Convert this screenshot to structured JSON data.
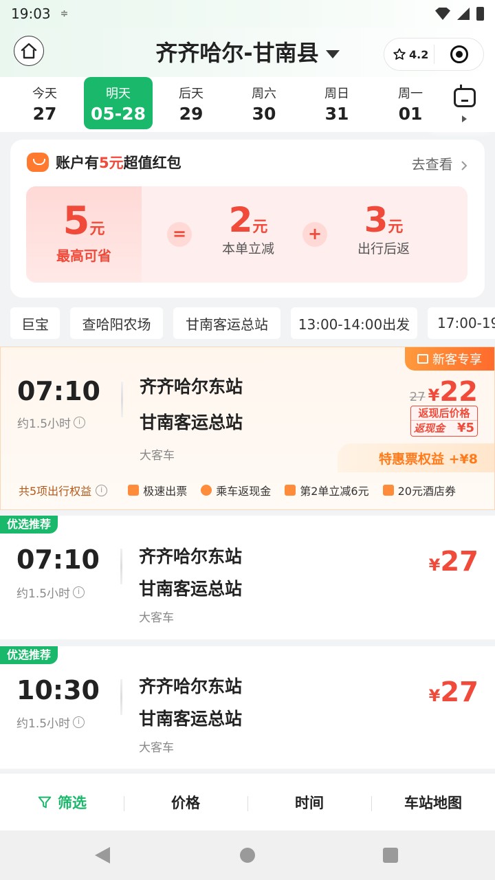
{
  "status": {
    "time": "19:03",
    "extra": "≑"
  },
  "header": {
    "title": "齐齐哈尔-甘南县",
    "rating": "4.2"
  },
  "dates": [
    {
      "weekday": "今天",
      "date": "27"
    },
    {
      "weekday": "明天",
      "date": "05-28"
    },
    {
      "weekday": "后天",
      "date": "29"
    },
    {
      "weekday": "周六",
      "date": "30"
    },
    {
      "weekday": "周日",
      "date": "31"
    },
    {
      "weekday": "周一",
      "date": "01"
    }
  ],
  "red_packet": {
    "prefix": "账户有",
    "amount": "5元",
    "suffix": "超值红包",
    "more": "去查看",
    "total": {
      "num": "5",
      "unit": "元",
      "label": "最高可省"
    },
    "eq": "=",
    "plus": "+",
    "part1": {
      "num": "2",
      "unit": "元",
      "label": "本单立减"
    },
    "part2": {
      "num": "3",
      "unit": "元",
      "label": "出行后返"
    }
  },
  "filters": [
    "巨宝",
    "查哈阳农场",
    "甘南客运总站",
    "13:00-14:00出发",
    "17:00-19"
  ],
  "special_card": {
    "tag": "新客专享",
    "time": "07:10",
    "duration": "约1.5小时",
    "from": "齐齐哈尔东站",
    "to": "甘南客运总站",
    "vehicle": "大客车",
    "old_price": "27",
    "yen": "¥",
    "price": "22",
    "cash_label": "返现后价格",
    "cash_key": "返现金",
    "cash_value": "¥5",
    "benefit": "特惠票权益 +¥8",
    "perks_lead": "共5项出行权益",
    "perks": [
      "极速出票",
      "乘车返现金",
      "第2单立减6元",
      "20元酒店券"
    ]
  },
  "cards": [
    {
      "tag": "优选推荐",
      "time": "07:10",
      "duration": "约1.5小时",
      "from": "齐齐哈尔东站",
      "to": "甘南客运总站",
      "vehicle": "大客车",
      "yen": "¥",
      "price": "27"
    },
    {
      "tag": "优选推荐",
      "time": "10:30",
      "duration": "约1.5小时",
      "from": "齐齐哈尔东站",
      "to": "甘南客运总站",
      "vehicle": "大客车",
      "yen": "¥",
      "price": "27"
    }
  ],
  "bottom_tabs": [
    "筛选",
    "价格",
    "时间",
    "车站地图"
  ],
  "colors": {
    "accent_green": "#19b86a",
    "price_red": "#f04a3a",
    "orange": "#ff7a1a"
  }
}
